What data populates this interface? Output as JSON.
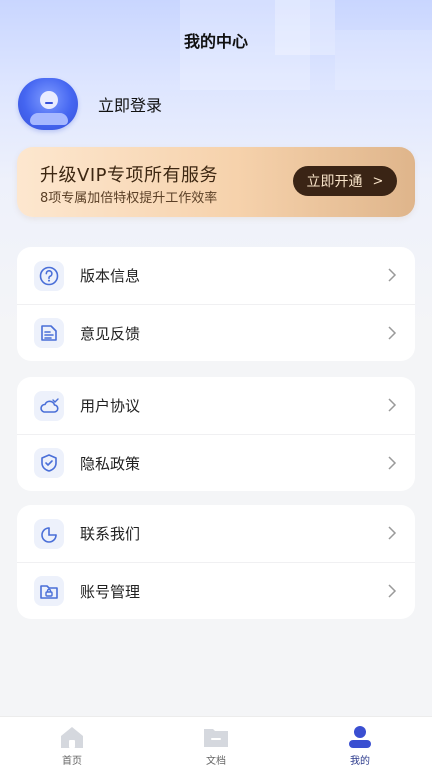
{
  "page": {
    "title": "我的中心"
  },
  "profile": {
    "login_label": "立即登录"
  },
  "vip": {
    "title": "升级VIP专项所有服务",
    "subtitle": "8项专属加倍特权提升工作效率",
    "button_label": "立即开通",
    "button_arrow": ">"
  },
  "menu_groups": [
    {
      "items": [
        {
          "label": "版本信息",
          "icon": "question-icon"
        },
        {
          "label": "意见反馈",
          "icon": "feedback-icon"
        }
      ]
    },
    {
      "items": [
        {
          "label": "用户协议",
          "icon": "cloud-icon"
        },
        {
          "label": "隐私政策",
          "icon": "shield-icon"
        }
      ]
    },
    {
      "items": [
        {
          "label": "联系我们",
          "icon": "pie-chart-icon"
        },
        {
          "label": "账号管理",
          "icon": "folder-lock-icon"
        }
      ]
    }
  ],
  "tabbar": {
    "tabs": [
      {
        "label": "首页",
        "icon": "home-icon"
      },
      {
        "label": "文档",
        "icon": "document-icon"
      },
      {
        "label": "我的",
        "icon": "user-icon",
        "active": true
      }
    ]
  },
  "colors": {
    "accent": "#4566f1",
    "vip_button": "#3a2415",
    "icon_stroke": "#4a6fd8"
  }
}
